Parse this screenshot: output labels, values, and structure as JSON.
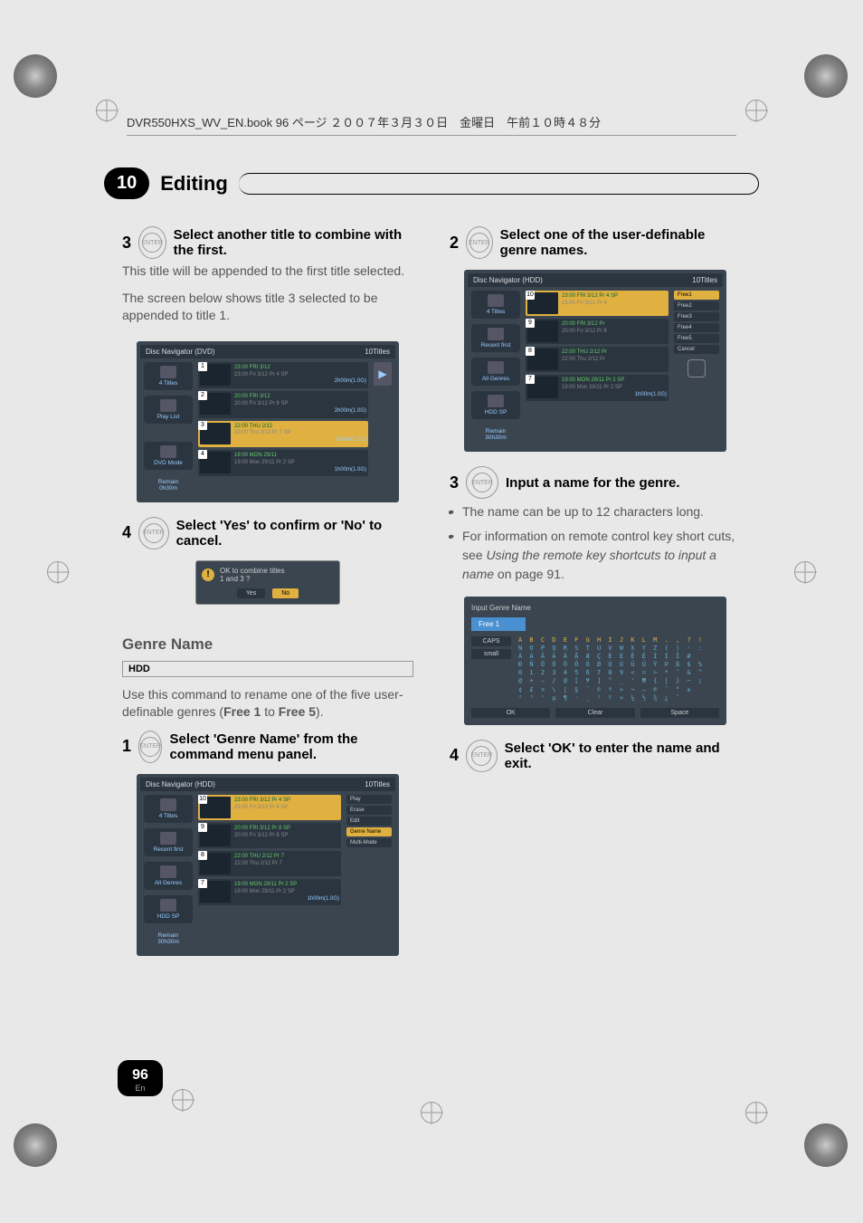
{
  "header": {
    "runhead": "DVR550HXS_WV_EN.book  96 ページ  ２００７年３月３０日　金曜日　午前１０時４８分"
  },
  "chapter": {
    "number": "10",
    "title": "Editing"
  },
  "left_column": {
    "step3": {
      "num": "3",
      "bold": "Select another title to combine with the first.",
      "para1": "This title will be appended to the first title selected.",
      "para2": "The screen below shows title 3 selected to be appended to title 1."
    },
    "screenshot1": {
      "title": "Disc Navigator (DVD)",
      "count": "10Titles",
      "side": [
        "4 Titles",
        "Play List",
        "",
        "DVD Mode"
      ],
      "remain_label": "Remain",
      "remain_value": "0h30m",
      "rows": [
        {
          "num": "1",
          "line1": "23:00  FRI  3/12",
          "line2": "23:00  Fri  3/12  Pr 4  SP",
          "dur": "2h00m(1.0G)"
        },
        {
          "num": "2",
          "line1": "20:00  FRI  3/12",
          "line2": "20:00  Fri  3/12  Pr 8  SP",
          "dur": "2h00m(1.0G)"
        },
        {
          "num": "3",
          "line1": "22:00  THU  2/12",
          "line2": "22:00  Thu  2/12  Pr 7  SP",
          "dur": "1h00m(1.0G)"
        },
        {
          "num": "4",
          "line1": "19:00  MON  29/11",
          "line2": "19:00  Mon  29/11  Pr 2  SP",
          "dur": "1h00m(1.0G)"
        }
      ]
    },
    "step4": {
      "num": "4",
      "bold": "Select 'Yes' to confirm or 'No' to cancel."
    },
    "dialog": {
      "line1": "OK to combine titles",
      "line2": "1 and 3 ?",
      "yes": "Yes",
      "no": "No"
    },
    "section_genre": {
      "title": "Genre Name",
      "badge": "HDD",
      "para": "Use this command to rename one of the five user-definable genres (",
      "para_b1": "Free 1",
      "para_mid": " to ",
      "para_b2": "Free 5",
      "para_end": ")."
    },
    "step1": {
      "num": "1",
      "bold": "Select 'Genre Name' from the command menu panel."
    },
    "screenshot2": {
      "title": "Disc Navigator (HDD)",
      "count": "10Titles",
      "side": [
        "4 Titles",
        "Recent first",
        "All Genres",
        "HDD SP"
      ],
      "remain_label": "Remain",
      "remain_value": "30h30m",
      "rows": [
        {
          "num": "10",
          "line1": "23:00  FRI  3/12  Pr 4  SP",
          "line2": "23:00  Fri  3/12  Pr 4  SP",
          "dur": ""
        },
        {
          "num": "9",
          "line1": "20:00  FRI  3/12  Pr 8  SP",
          "line2": "20:00  Fri  3/12  Pr 8  SP",
          "dur": ""
        },
        {
          "num": "8",
          "line1": "22:00  THU  2/12  Pr 7",
          "line2": "22:00  Thu  2/12  Pr 7",
          "dur": ""
        },
        {
          "num": "7",
          "line1": "19:00  MON  29/11  Pr 2  SP",
          "line2": "19:00  Mon  29/11  Pr 2  SP",
          "dur": "1h00m(1.0G)"
        }
      ],
      "menu": [
        "Play",
        "Erase",
        "Edit",
        "Genre Name",
        "Multi-Mode"
      ]
    }
  },
  "right_column": {
    "step2": {
      "num": "2",
      "bold": "Select one of the user-definable genre names."
    },
    "screenshot3": {
      "title": "Disc Navigator (HDD)",
      "count": "10Titles",
      "side": [
        "4 Titles",
        "Recent first",
        "All Genres",
        "HDD SP"
      ],
      "remain_label": "Remain",
      "remain_value": "30h30m",
      "rows": [
        {
          "num": "10",
          "line1": "23:00  FRI  3/12  Pr 4  SP",
          "line2": "23:00  Fri  3/12  Pr 4",
          "dur": ""
        },
        {
          "num": "9",
          "line1": "20:00  FRI  3/12  Pr",
          "line2": "20:00  Fri  3/12  Pr 8",
          "dur": ""
        },
        {
          "num": "8",
          "line1": "22:00  THU  2/12  Pr",
          "line2": "22:00  Thu  2/12  Pr",
          "dur": ""
        },
        {
          "num": "7",
          "line1": "19:00  MON  29/11  Pr 2  SP",
          "line2": "19:00  Mon  29/11  Pr 2  SP",
          "dur": "1h00m(1.0G)"
        }
      ],
      "genres": [
        "Free1",
        "Free2",
        "Free3",
        "Free4",
        "Free5",
        "Cancel"
      ]
    },
    "step3r": {
      "num": "3",
      "bold": "Input a name for the genre.",
      "bullets": [
        "The name can be up to 12 characters long.",
        "For information on remote control key short cuts, see "
      ],
      "italic_ref": "Using the remote key shortcuts to input a name",
      "ref_tail": " on page 91."
    },
    "keyboard": {
      "header": "Input Genre Name",
      "field": "Free 1",
      "caps": "CAPS",
      "small": "small",
      "ok": "OK",
      "clear": "Clear",
      "space": "Space",
      "lines": [
        "A B C D E F G H I J K L M . , ? !",
        "N O P Q R S T U V W X Y Z ( ) - :",
        "À Á Â Ã Ä Å Æ Ç È É Ê Ë Ì Í Î #",
        "Ð Ñ Ò Ó Ô Õ Ö Ø Ù Ú Û Ü Ý Þ ß $ %",
        "0 1 2 3 4 5 6 7 8 9 < = > * ˜ & ^",
        "@ + – / @ [ ¥ ] ^ _ ' ₩ { | } ~ ¡",
        "¢ £ ¤ \\ | § ¨ © ª « ¬ – ® ¯ ° ±",
        "² ³ ' µ ¶ · ¸ ¹ º » ¼ ½ ¾ ¿ ˆ"
      ]
    },
    "step4r": {
      "num": "4",
      "bold": "Select 'OK' to enter the name and exit."
    }
  },
  "footer": {
    "page": "96",
    "lang": "En"
  },
  "enter_label": "ENTER"
}
